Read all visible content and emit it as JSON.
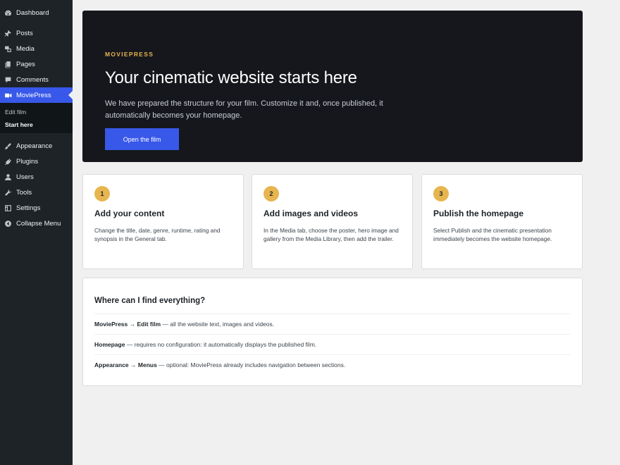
{
  "sidebar": {
    "items": [
      {
        "label": "Dashboard",
        "icon": "dashboard-icon"
      },
      {
        "label": "Posts",
        "icon": "pin-icon"
      },
      {
        "label": "Media",
        "icon": "media-icon"
      },
      {
        "label": "Pages",
        "icon": "pages-icon"
      },
      {
        "label": "Comments",
        "icon": "comment-icon"
      },
      {
        "label": "MoviePress",
        "icon": "video-icon"
      },
      {
        "label": "Appearance",
        "icon": "brush-icon"
      },
      {
        "label": "Plugins",
        "icon": "plug-icon"
      },
      {
        "label": "Users",
        "icon": "user-icon"
      },
      {
        "label": "Tools",
        "icon": "wrench-icon"
      },
      {
        "label": "Settings",
        "icon": "settings-icon"
      },
      {
        "label": "Collapse Menu",
        "icon": "collapse-icon"
      }
    ],
    "submenu": [
      "Edit film",
      "Start here"
    ],
    "accent": "#3858e9"
  },
  "hero": {
    "eyebrow": "MOVIEPRESS",
    "title": "Your cinematic website starts here",
    "description": "We have prepared the structure for your film. Customize it and, once published, it automatically becomes your homepage.",
    "button": "Open the film"
  },
  "steps": [
    {
      "num": "1",
      "title": "Add your content",
      "text": "Change the title, date, genre, runtime, rating and synopsis in the General tab."
    },
    {
      "num": "2",
      "title": "Add images and videos",
      "text": "In the Media tab, choose the poster, hero image and gallery from the Media Library, then add the trailer."
    },
    {
      "num": "3",
      "title": "Publish the homepage",
      "text": "Select Publish and the cinematic presentation immediately becomes the website homepage."
    }
  ],
  "where": {
    "title": "Where can I find everything?",
    "rows": [
      {
        "bold": "MoviePress → Edit film",
        "rest": " — all the website text, images and videos."
      },
      {
        "bold": "Homepage",
        "rest": " — requires no configuration: it automatically displays the published film."
      },
      {
        "bold": "Appearance → Menus",
        "rest": " — optional: MoviePress already includes navigation between sections."
      }
    ]
  }
}
